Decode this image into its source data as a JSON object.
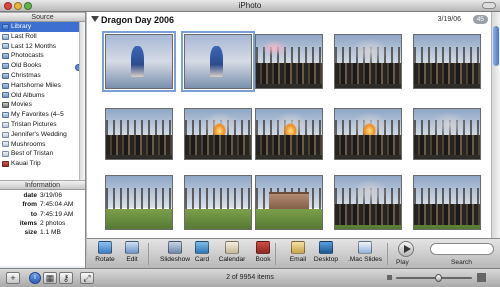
{
  "window": {
    "title": "iPhoto"
  },
  "sidebar": {
    "source_header": "Source",
    "items": [
      {
        "label": "Library",
        "icon": "library-icon",
        "selected": true
      },
      {
        "label": "Last Roll",
        "icon": "smart-album-icon"
      },
      {
        "label": "Last 12 Months",
        "icon": "smart-album-icon"
      },
      {
        "label": "Photocasts",
        "icon": "folder-icon"
      },
      {
        "label": "Old Books",
        "icon": "folder-icon"
      },
      {
        "label": "Christmas",
        "icon": "folder-icon"
      },
      {
        "label": "Hartshorne Miles",
        "icon": "folder-icon"
      },
      {
        "label": "Old Albums",
        "icon": "folder-icon"
      },
      {
        "label": "Movies",
        "icon": "movies-icon"
      },
      {
        "label": "My Favorites (4–5",
        "icon": "smart-album-icon"
      },
      {
        "label": "Tristan Pictures",
        "icon": "album-icon"
      },
      {
        "label": "Jennifer's Wedding",
        "icon": "album-icon"
      },
      {
        "label": "Mushrooms",
        "icon": "album-icon"
      },
      {
        "label": "Best of Tristan",
        "icon": "album-icon"
      },
      {
        "label": "Kauai Trip",
        "icon": "book-icon"
      }
    ],
    "info_header": "Information",
    "info": [
      {
        "key": "date",
        "value": "3/19/06"
      },
      {
        "key": "from",
        "value": "7:45:04 AM"
      },
      {
        "key": "to",
        "value": "7:45:19 AM"
      },
      {
        "key": "items",
        "value": "2 photos"
      },
      {
        "key": "size",
        "value": "1.1 MB"
      }
    ]
  },
  "roll": {
    "title": "Dragon Day 2006",
    "date": "3/19/06",
    "count": "45"
  },
  "photos": [
    {
      "kind": "kid",
      "selected": true
    },
    {
      "kind": "room-kid",
      "selected": true
    },
    {
      "kind": "crowd-pink"
    },
    {
      "kind": "crowd-smoke"
    },
    {
      "kind": "crowd"
    },
    {
      "kind": "crowd-people"
    },
    {
      "kind": "crowd-fire"
    },
    {
      "kind": "crowd-fire"
    },
    {
      "kind": "crowd-fire"
    },
    {
      "kind": "crowd-smoke"
    },
    {
      "kind": "trees-grass"
    },
    {
      "kind": "trees-person"
    },
    {
      "kind": "house-grass"
    },
    {
      "kind": "structure-grass"
    },
    {
      "kind": "crowd-grass"
    }
  ],
  "toolbar": {
    "tools": [
      {
        "label": "Rotate",
        "icon": "rotate-icon"
      },
      {
        "label": "Edit",
        "icon": "edit-icon"
      },
      {
        "label": "Slideshow",
        "icon": "slideshow-icon"
      },
      {
        "label": "Card",
        "icon": "card-icon"
      },
      {
        "label": "Calendar",
        "icon": "calendar-icon"
      },
      {
        "label": "Book",
        "icon": "book-icon"
      },
      {
        "label": "Email",
        "icon": "email-icon"
      },
      {
        "label": "Desktop",
        "icon": "desktop-icon"
      },
      {
        "label": ".Mac Slides",
        "icon": "mac-slides-icon"
      }
    ],
    "play_label": "Play",
    "search_label": "Search"
  },
  "status": {
    "text": "2 of 9954 items",
    "zoom_level": 0.55
  }
}
